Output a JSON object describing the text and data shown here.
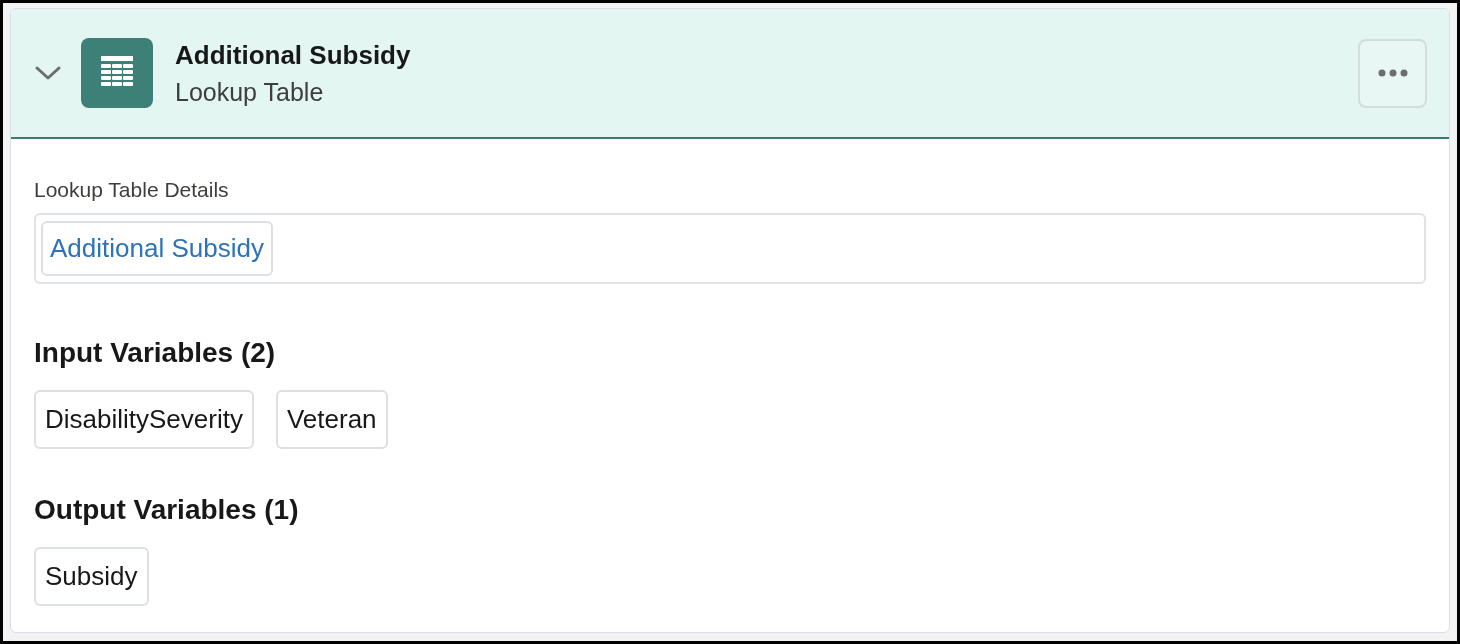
{
  "card": {
    "expanded": true,
    "title": "Additional Subsidy",
    "subtitle": "Lookup Table",
    "details": {
      "label": "Lookup Table Details",
      "value": "Additional Subsidy"
    },
    "sections": [
      {
        "heading": "Input Variables (2)",
        "variables": [
          "DisabilitySeverity",
          "Veteran"
        ]
      },
      {
        "heading": "Output Variables (1)",
        "variables": [
          "Subsidy"
        ]
      }
    ]
  }
}
